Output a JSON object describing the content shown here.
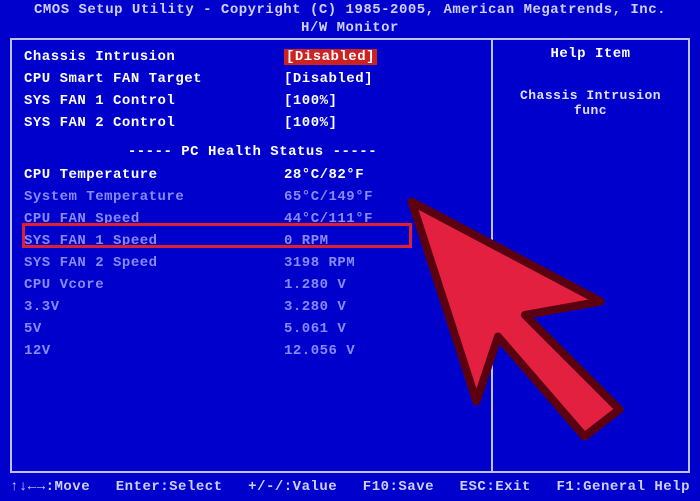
{
  "header": {
    "title": "CMOS Setup Utility - Copyright (C) 1985-2005, American Megatrends, Inc.",
    "section": "H/W Monitor"
  },
  "settings": [
    {
      "label": "Chassis Intrusion",
      "value": "[Disabled]",
      "selected": true
    },
    {
      "label": "CPU Smart FAN Target",
      "value": "[Disabled]",
      "selected": false
    },
    {
      "label": "SYS FAN 1 Control",
      "value": "[100%]",
      "selected": false
    },
    {
      "label": "SYS FAN 2 Control",
      "value": "[100%]",
      "selected": false
    }
  ],
  "divider": "----- PC Health Status -----",
  "health": [
    {
      "label": "CPU Temperature",
      "value": "28°C/82°F",
      "highlight": true
    },
    {
      "label": "System Temperature",
      "value": "65°C/149°F",
      "highlight": false
    },
    {
      "label": "CPU FAN Speed",
      "value": "44°C/111°F",
      "highlight": false
    },
    {
      "label": "SYS FAN 1 Speed",
      "value": "0 RPM",
      "highlight": false
    },
    {
      "label": "SYS FAN 2 Speed",
      "value": "3198 RPM",
      "highlight": false
    },
    {
      "label": "CPU Vcore",
      "value": "1.280 V",
      "highlight": false
    },
    {
      "label": "3.3V",
      "value": "3.280 V",
      "highlight": false
    },
    {
      "label": "5V",
      "value": "5.061 V",
      "highlight": false
    },
    {
      "label": "12V",
      "value": "12.056 V",
      "highlight": false
    }
  ],
  "help": {
    "title": "Help Item",
    "text": "Chassis Intrusion func"
  },
  "footer": {
    "move": "↑↓←→:Move",
    "select": "Enter:Select",
    "value": "+/-/:Value",
    "save": "F10:Save",
    "exit": "ESC:Exit",
    "general": "F1:General Help"
  }
}
